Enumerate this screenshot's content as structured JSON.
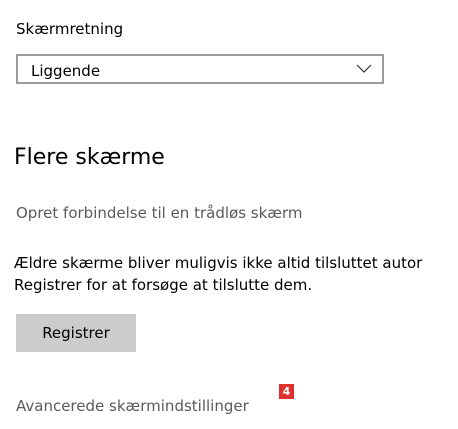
{
  "orientation": {
    "label": "Skærmretning",
    "selected_value": "Liggende"
  },
  "multiple_displays": {
    "heading": "Flere skærme",
    "connect_link": "Opret forbindelse til en trådløs skærm",
    "description_line1": "Ældre skærme bliver muligvis ikke altid tilsluttet autor",
    "description_line2": "Registrer for at forsøge at tilslutte dem.",
    "register_button": "Registrer"
  },
  "advanced_link": "Avancerede skærmindstillinger",
  "badge": {
    "value": "4",
    "color": "#e0312b"
  },
  "colors": {
    "link_text": "#5a5a5a",
    "button_bg": "#cccccc",
    "dropdown_border": "#9a9a9a"
  },
  "icons": {
    "dropdown_chevron": "chevron-down-icon"
  }
}
